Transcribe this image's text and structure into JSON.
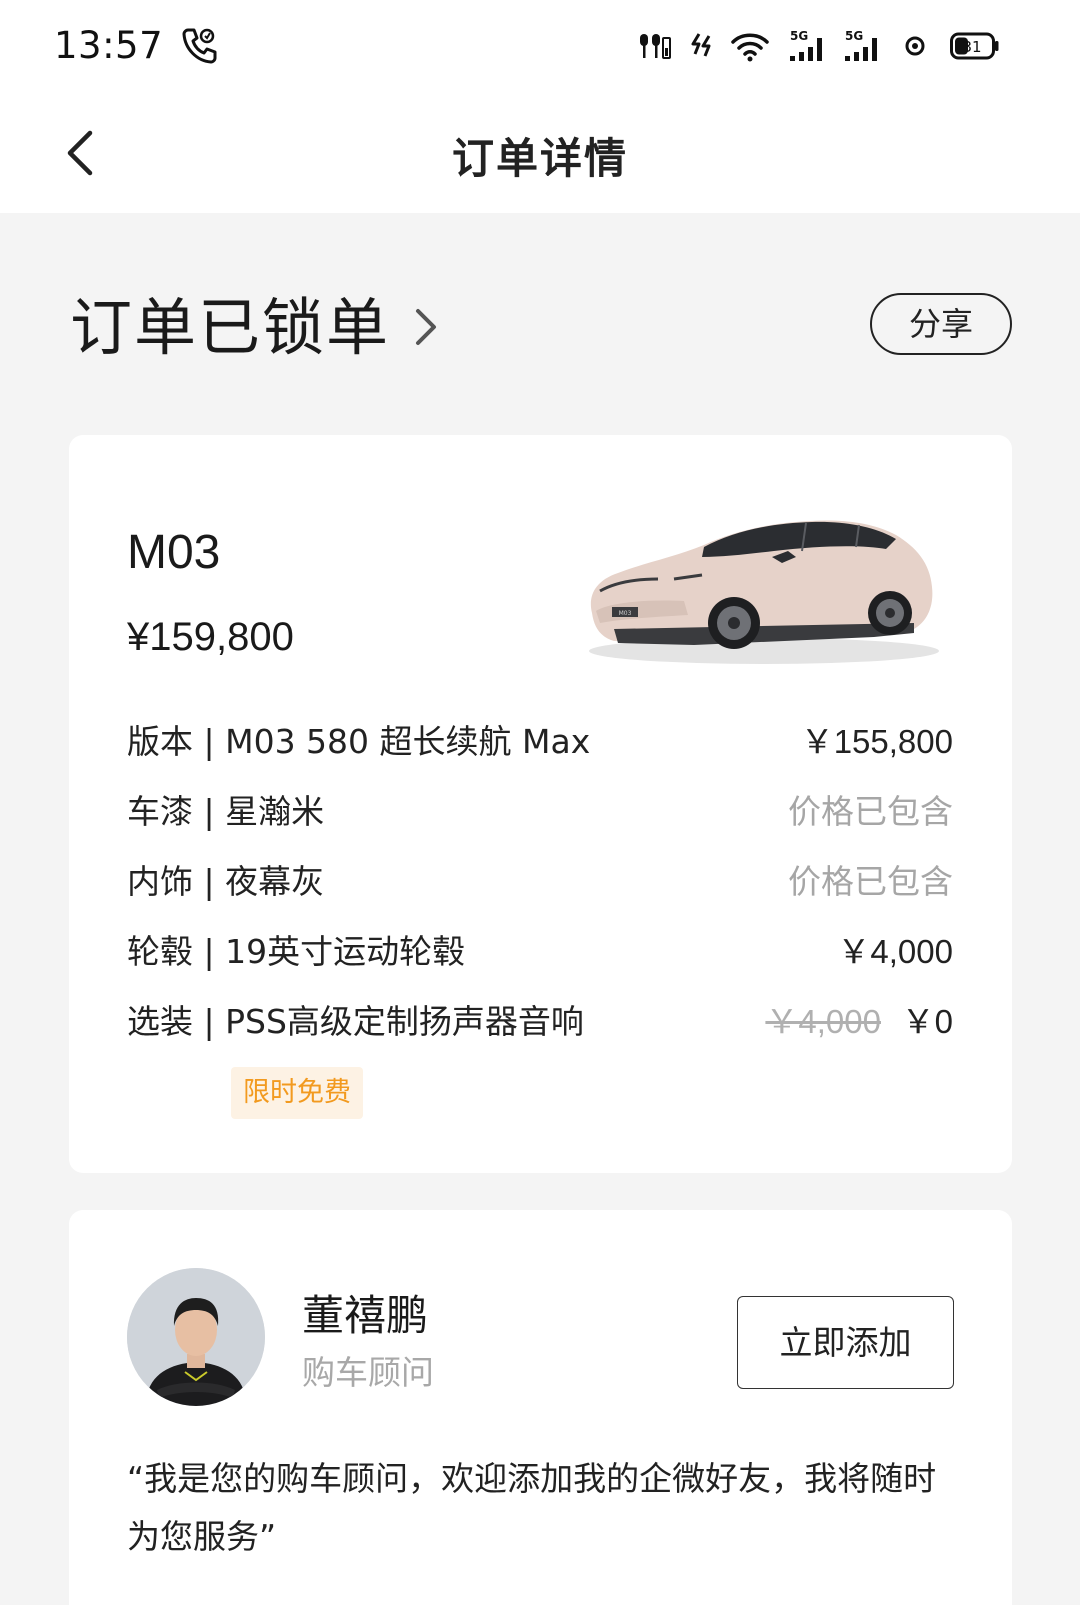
{
  "status_bar": {
    "time": "13:57",
    "battery": "31",
    "network_1": "5G",
    "network_2": "5G"
  },
  "nav": {
    "title": "订单详情"
  },
  "order": {
    "status": "订单已锁单",
    "share_label": "分享"
  },
  "car": {
    "model": "M03",
    "total_price": "¥159,800",
    "plate_text": "M03",
    "options": [
      {
        "label": "版本 | M03 580 超长续航 Max",
        "price": "￥155,800"
      },
      {
        "label": "车漆 | 星瀚米",
        "price": "价格已包含"
      },
      {
        "label": "内饰 | 夜幕灰",
        "price": "价格已包含"
      },
      {
        "label": "轮毂 | 19英寸运动轮毂",
        "price": "￥4,000"
      },
      {
        "label": "选装 | PSS高级定制扬声器音响",
        "original_price": "￥4,000",
        "price": "￥0",
        "tag": "限时免费"
      }
    ]
  },
  "advisor": {
    "name": "董禧鹏",
    "role": "购车顾问",
    "add_label": "立即添加",
    "quote": "“我是您的购车顾问，欢迎添加我的企微好友，我将随时为您服务”"
  },
  "colors": {
    "background": "#f4f4f4",
    "card": "#ffffff",
    "muted_text": "#a6a6a6",
    "promo_text": "#f29a1f",
    "promo_bg": "#fdf2e4",
    "car_body": "#e6d2c9"
  }
}
